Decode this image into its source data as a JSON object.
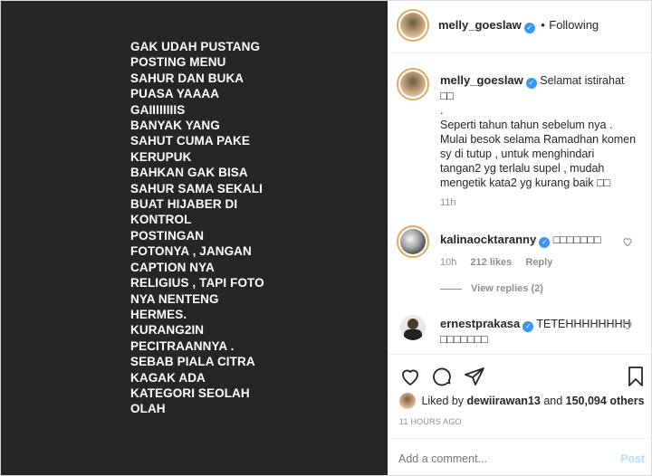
{
  "post_text": [
    "GAK UDAH PUSTANG",
    "POSTING MENU",
    "SAHUR DAN BUKA",
    "PUASA YAAAA",
    "GAIIIIIIIIS",
    "BANYAK YANG",
    "SAHUT CUMA PAKE",
    "KERUPUK",
    "BAHKAN GAK BISA",
    "SAHUR SAMA SEKALI",
    "BUAT HIJABER DI",
    "KONTROL",
    "POSTINGAN",
    "FOTONYA , JANGAN",
    "CAPTION NYA",
    "RELIGIUS , TAPI FOTO",
    "NYA NENTENG",
    "HERMES.",
    "KURANG2IN",
    "PECITRAANNYA .",
    "SEBAB PIALA CITRA",
    "KAGAK ADA",
    "KATEGORI SEOLAH",
    "OLAH"
  ],
  "header": {
    "username": "melly_goeslaw",
    "separator": "•",
    "follow_status": "Following"
  },
  "caption": {
    "username": "melly_goeslaw",
    "line1": "Selamat istirahat",
    "line2": "□□",
    "line3": ".",
    "line4": "Seperti tahun tahun sebelum nya .",
    "line5": "Mulai besok selama Ramadhan komen",
    "line6": "sy di tutup , untuk menghindari",
    "line7": "tangan2 yg terlalu supel , mudah",
    "line8": "mengetik kata2 yg kurang baik  □□",
    "time": "11h"
  },
  "comments": [
    {
      "username": "kalinaocktaranny",
      "text": "□□□□□□□",
      "time": "10h",
      "likes": "212 likes",
      "reply": "Reply",
      "view_replies": "View replies (2)"
    },
    {
      "username": "ernestprakasa",
      "text": "TETEHHHHHHHH",
      "text2": "□□□□□□□"
    }
  ],
  "likes": {
    "prefix": "Liked by",
    "user": "dewiirawan13",
    "and": "and",
    "count": "150,094 others"
  },
  "post_time": "11 HOURS AGO",
  "comment_input": {
    "placeholder": "Add a comment...",
    "post_label": "Post"
  },
  "colors": {
    "verified": "#3897f0",
    "post_bg": "#262626",
    "muted": "#8e8e8e",
    "post_button": "#b2dffc"
  },
  "icons": [
    "heart-icon",
    "comment-icon",
    "share-icon",
    "bookmark-icon",
    "verified-icon",
    "like-heart-icon"
  ]
}
